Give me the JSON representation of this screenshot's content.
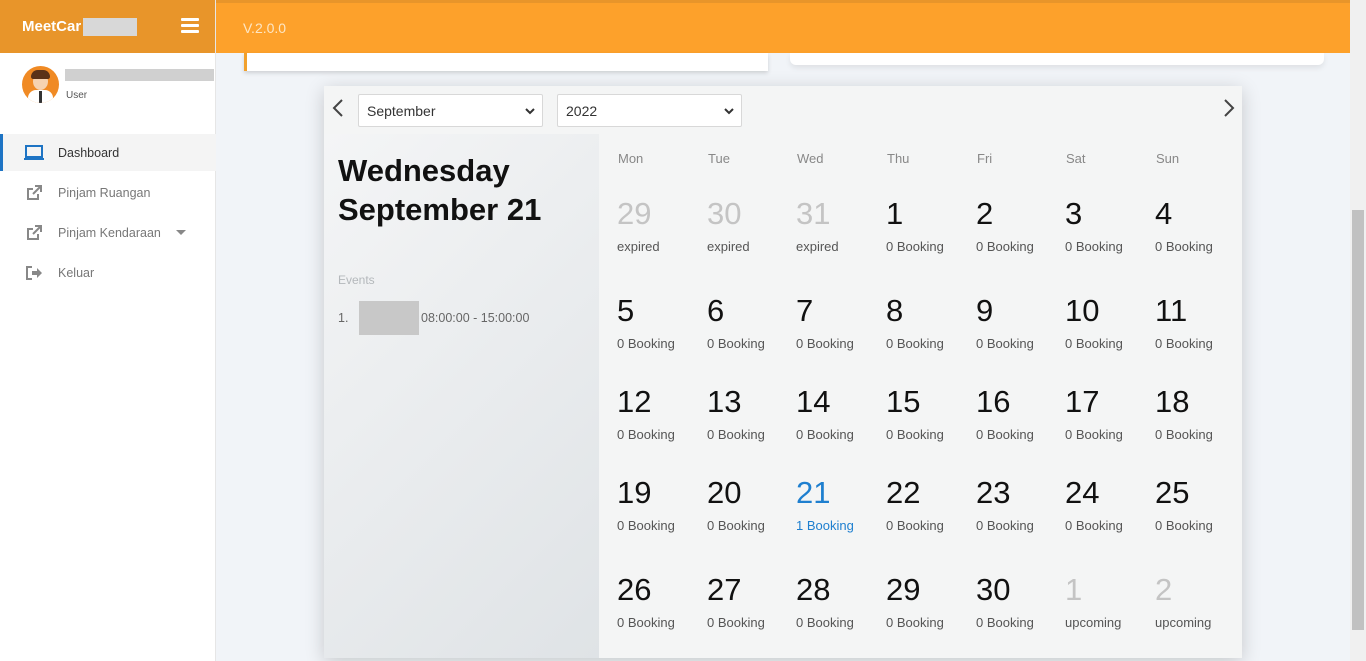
{
  "app": {
    "brand": "MeetCar",
    "version": "V.2.0.0"
  },
  "user": {
    "role": "User"
  },
  "nav": [
    {
      "label": "Dashboard",
      "icon": "laptop-icon",
      "active": true
    },
    {
      "label": "Pinjam Ruangan",
      "icon": "external-link-icon"
    },
    {
      "label": "Pinjam Kendaraan",
      "icon": "external-link-icon",
      "dropdown": true
    },
    {
      "label": "Keluar",
      "icon": "sign-out-icon"
    }
  ],
  "calendar": {
    "month": "September",
    "year": "2022",
    "weekday": "Wednesday",
    "month_day": "September 21",
    "events_label": "Events",
    "events": [
      {
        "num": "1.",
        "time": "08:00:00 - 15:00:00"
      }
    ],
    "weekdays": [
      "Mon",
      "Tue",
      "Wed",
      "Thu",
      "Fri",
      "Sat",
      "Sun"
    ],
    "today_color": "#1e7fcf",
    "weeks": [
      [
        {
          "d": "29",
          "s": "expired",
          "state": "muted"
        },
        {
          "d": "30",
          "s": "expired",
          "state": "muted"
        },
        {
          "d": "31",
          "s": "expired",
          "state": "muted"
        },
        {
          "d": "1",
          "s": "0 Booking"
        },
        {
          "d": "2",
          "s": "0 Booking"
        },
        {
          "d": "3",
          "s": "0 Booking"
        },
        {
          "d": "4",
          "s": "0 Booking"
        }
      ],
      [
        {
          "d": "5",
          "s": "0 Booking"
        },
        {
          "d": "6",
          "s": "0 Booking"
        },
        {
          "d": "7",
          "s": "0 Booking"
        },
        {
          "d": "8",
          "s": "0 Booking"
        },
        {
          "d": "9",
          "s": "0 Booking"
        },
        {
          "d": "10",
          "s": "0 Booking"
        },
        {
          "d": "11",
          "s": "0 Booking"
        }
      ],
      [
        {
          "d": "12",
          "s": "0 Booking"
        },
        {
          "d": "13",
          "s": "0 Booking"
        },
        {
          "d": "14",
          "s": "0 Booking"
        },
        {
          "d": "15",
          "s": "0 Booking"
        },
        {
          "d": "16",
          "s": "0 Booking"
        },
        {
          "d": "17",
          "s": "0 Booking"
        },
        {
          "d": "18",
          "s": "0 Booking"
        }
      ],
      [
        {
          "d": "19",
          "s": "0 Booking"
        },
        {
          "d": "20",
          "s": "0 Booking"
        },
        {
          "d": "21",
          "s": "1 Booking",
          "state": "today"
        },
        {
          "d": "22",
          "s": "0 Booking"
        },
        {
          "d": "23",
          "s": "0 Booking"
        },
        {
          "d": "24",
          "s": "0 Booking"
        },
        {
          "d": "25",
          "s": "0 Booking"
        }
      ],
      [
        {
          "d": "26",
          "s": "0 Booking"
        },
        {
          "d": "27",
          "s": "0 Booking"
        },
        {
          "d": "28",
          "s": "0 Booking"
        },
        {
          "d": "29",
          "s": "0 Booking"
        },
        {
          "d": "30",
          "s": "0 Booking"
        },
        {
          "d": "1",
          "s": "upcoming",
          "state": "muted"
        },
        {
          "d": "2",
          "s": "upcoming",
          "state": "muted"
        }
      ]
    ]
  },
  "colors": {
    "topbar": "#fda12b",
    "brand": "#e8952a",
    "active": "#1e74c4"
  }
}
